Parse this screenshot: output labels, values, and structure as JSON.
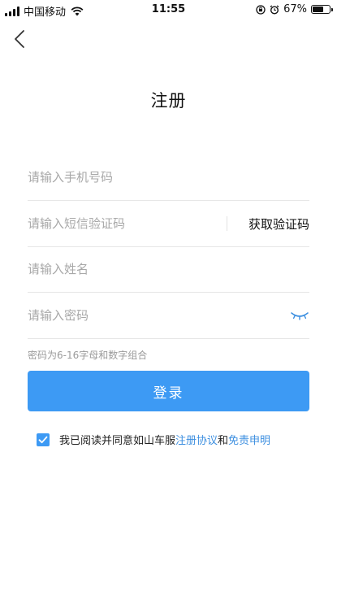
{
  "status_bar": {
    "carrier": "中国移动",
    "time": "11:55",
    "battery": "67%",
    "battery_level": 0.67
  },
  "title": "注册",
  "fields": {
    "phone_placeholder": "请输入手机号码",
    "sms_placeholder": "请输入短信验证码",
    "get_code_label": "获取验证码",
    "name_placeholder": "请输入姓名",
    "password_placeholder": "请输入密码"
  },
  "password_hint": "密码为6-16字母和数字组合",
  "login_label": "登录",
  "agreement": {
    "checked": true,
    "prefix": "我已阅读并同意如山车服",
    "terms_link": "注册协议",
    "conjunction": "和",
    "disclaimer_link": "免责申明"
  },
  "colors": {
    "accent": "#3d9af4",
    "link": "#3d8fe0"
  }
}
